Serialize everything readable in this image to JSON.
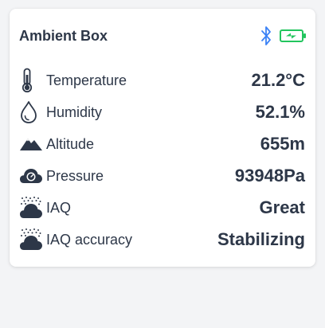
{
  "card": {
    "title": "Ambient Box",
    "status_icons": [
      "bluetooth-icon",
      "battery-charging-icon"
    ],
    "colors": {
      "bluetooth": "#3b82f6",
      "battery": "#22c55e",
      "text": "#2d3748"
    }
  },
  "readings": [
    {
      "icon": "thermometer-icon",
      "label": "Temperature",
      "value": "21.2°C"
    },
    {
      "icon": "droplet-icon",
      "label": "Humidity",
      "value": "52.1%"
    },
    {
      "icon": "mountain-icon",
      "label": "Altitude",
      "value": "655m"
    },
    {
      "icon": "cloud-gauge-icon",
      "label": "Pressure",
      "value": "93948Pa"
    },
    {
      "icon": "cloud-particles-icon",
      "label": "IAQ",
      "value": "Great"
    },
    {
      "icon": "cloud-particles-icon",
      "label": "IAQ accuracy",
      "value": "Stabilizing"
    }
  ]
}
